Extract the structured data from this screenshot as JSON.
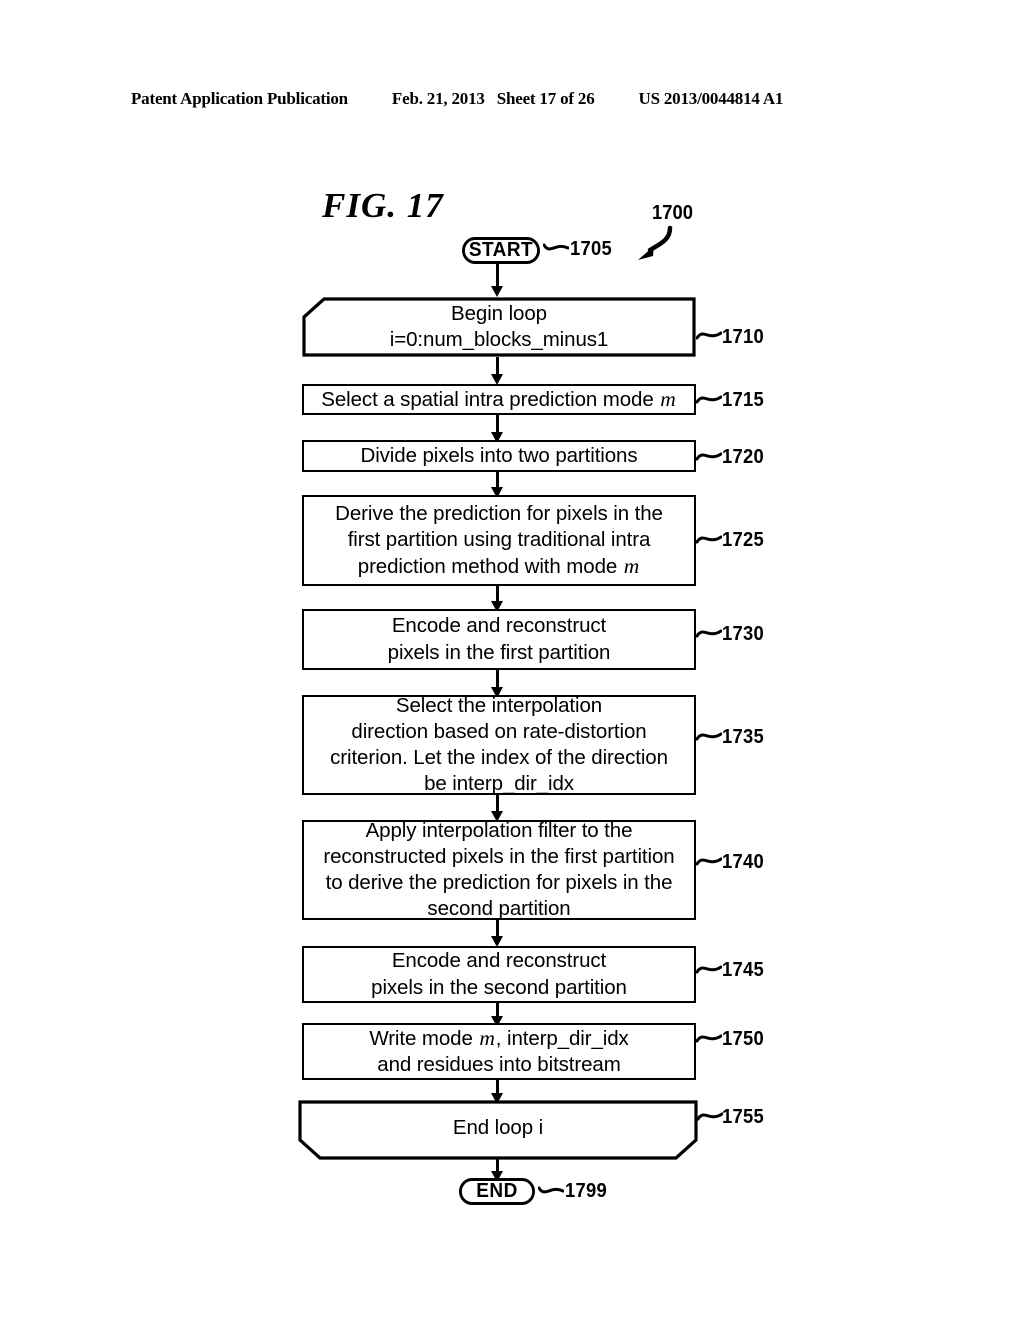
{
  "header": {
    "publication": "Patent Application Publication",
    "date": "Feb. 21, 2013",
    "sheet": "Sheet 17 of 26",
    "patent_number": "US 2013/0044814 A1"
  },
  "figure": {
    "title": "FIG. 17",
    "figure_ref": "1700"
  },
  "flowchart": {
    "start": {
      "label": "START",
      "ref": "1705"
    },
    "end": {
      "label": "END",
      "ref": "1799"
    },
    "steps": [
      {
        "ref": "1710",
        "shape": "loop-begin",
        "lines": [
          "Begin loop",
          "i=0:num_blocks_minus1"
        ]
      },
      {
        "ref": "1715",
        "shape": "process",
        "lines": [
          "Select a spatial intra prediction mode <em class=\"var\">m</em>"
        ]
      },
      {
        "ref": "1720",
        "shape": "process",
        "lines": [
          "Divide pixels into two partitions"
        ]
      },
      {
        "ref": "1725",
        "shape": "process",
        "lines": [
          "Derive the prediction for pixels in the",
          "first partition using traditional intra",
          "prediction method with mode <em class=\"var\">m</em>"
        ]
      },
      {
        "ref": "1730",
        "shape": "process",
        "lines": [
          "Encode and reconstruct",
          "pixels in the first partition"
        ]
      },
      {
        "ref": "1735",
        "shape": "process",
        "lines": [
          "Select the interpolation",
          "direction based on rate-distortion",
          "criterion. Let the index of the direction",
          "be interp_dir_idx"
        ]
      },
      {
        "ref": "1740",
        "shape": "process",
        "lines": [
          "Apply interpolation filter to the",
          "reconstructed pixels in the first partition",
          "to derive the prediction for pixels in the",
          "second partition"
        ]
      },
      {
        "ref": "1745",
        "shape": "process",
        "lines": [
          "Encode and reconstruct",
          "pixels in the second partition"
        ]
      },
      {
        "ref": "1750",
        "shape": "process",
        "lines": [
          "Write mode <em class=\"var\">m</em>, interp_dir_idx",
          "and residues into bitstream"
        ]
      },
      {
        "ref": "1755",
        "shape": "loop-end",
        "lines": [
          "End loop i"
        ]
      }
    ]
  }
}
